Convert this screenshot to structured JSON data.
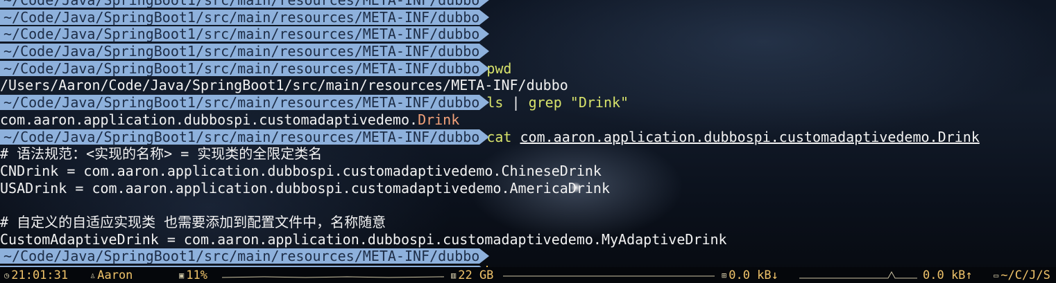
{
  "prompt_path": "~/Code/Java/SpringBoot1/src/main/resources/META-INF/dubbo",
  "commands": {
    "pwd": "pwd",
    "ls": "ls",
    "pipe": "|",
    "grep": "grep",
    "grep_arg": "\"Drink\"",
    "cat": "cat",
    "cat_arg": "com.aaron.application.dubbospi.customadaptivedemo.Drink"
  },
  "output": {
    "pwd_result": "/Users/Aaron/Code/Java/SpringBoot1/src/main/resources/META-INF/dubbo",
    "ls_prefix": "com.aaron.application.dubbospi.customadaptivedemo.",
    "ls_match": "Drink",
    "file_lines": [
      "# 语法规范：<实现的名称> = 实现类的全限定类名",
      "CNDrink = com.aaron.application.dubbospi.customadaptivedemo.ChineseDrink",
      "USADrink = com.aaron.application.dubbospi.customadaptivedemo.AmericaDrink",
      "",
      "# 自定义的自适应实现类 也需要添加到配置文件中，名称随意",
      "CustomAdaptiveDrink = com.aaron.application.dubbospi.customadaptivedemo.MyAdaptiveDrink"
    ]
  },
  "status_bar": {
    "time": "21:01:31",
    "user": "Aaron",
    "cpu": "11%",
    "memory": "22 GB",
    "net_down": "0.0 kB↓",
    "net_up": "0.0 kB↑",
    "cwd": "~/C/J/S",
    "icons": [
      "clock-icon",
      "user-icon",
      "cpu-icon",
      "memory-icon",
      "network-icon",
      "folder-icon"
    ],
    "accent": "#f0c36a"
  },
  "colors": {
    "prompt_bg": "#8eb1dc",
    "prompt_fg": "#1d2d47",
    "command": "#d8e36b",
    "match_highlight": "#f4a27a",
    "cursor": "#e8b64a"
  }
}
